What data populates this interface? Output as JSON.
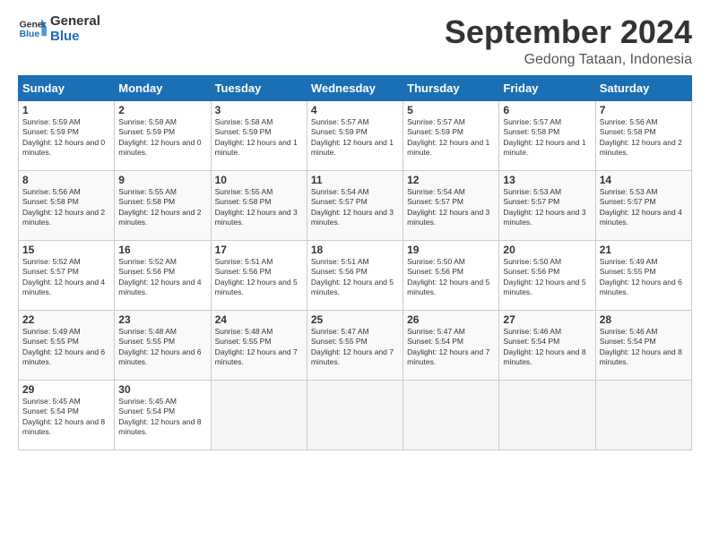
{
  "app": {
    "name": "GeneralBlue",
    "logo_text_line1": "General",
    "logo_text_line2": "Blue"
  },
  "calendar": {
    "month_title": "September 2024",
    "location": "Gedong Tataan, Indonesia",
    "days_of_week": [
      "Sunday",
      "Monday",
      "Tuesday",
      "Wednesday",
      "Thursday",
      "Friday",
      "Saturday"
    ],
    "weeks": [
      [
        {
          "day": "",
          "empty": true
        },
        {
          "day": "",
          "empty": true
        },
        {
          "day": "",
          "empty": true
        },
        {
          "day": "",
          "empty": true
        },
        {
          "day": "",
          "empty": true
        },
        {
          "day": "",
          "empty": true
        },
        {
          "day": "7",
          "sunrise": "5:56 AM",
          "sunset": "5:58 PM",
          "daylight": "12 hours and 2 minutes."
        }
      ],
      [
        {
          "day": "1",
          "sunrise": "5:59 AM",
          "sunset": "5:59 PM",
          "daylight": "12 hours and 0 minutes."
        },
        {
          "day": "2",
          "sunrise": "5:58 AM",
          "sunset": "5:59 PM",
          "daylight": "12 hours and 0 minutes."
        },
        {
          "day": "3",
          "sunrise": "5:58 AM",
          "sunset": "5:59 PM",
          "daylight": "12 hours and 1 minute."
        },
        {
          "day": "4",
          "sunrise": "5:57 AM",
          "sunset": "5:59 PM",
          "daylight": "12 hours and 1 minute."
        },
        {
          "day": "5",
          "sunrise": "5:57 AM",
          "sunset": "5:59 PM",
          "daylight": "12 hours and 1 minute."
        },
        {
          "day": "6",
          "sunrise": "5:57 AM",
          "sunset": "5:58 PM",
          "daylight": "12 hours and 1 minute."
        },
        {
          "day": "7",
          "sunrise": "5:56 AM",
          "sunset": "5:58 PM",
          "daylight": "12 hours and 2 minutes."
        }
      ],
      [
        {
          "day": "8",
          "sunrise": "5:56 AM",
          "sunset": "5:58 PM",
          "daylight": "12 hours and 2 minutes."
        },
        {
          "day": "9",
          "sunrise": "5:55 AM",
          "sunset": "5:58 PM",
          "daylight": "12 hours and 2 minutes."
        },
        {
          "day": "10",
          "sunrise": "5:55 AM",
          "sunset": "5:58 PM",
          "daylight": "12 hours and 3 minutes."
        },
        {
          "day": "11",
          "sunrise": "5:54 AM",
          "sunset": "5:57 PM",
          "daylight": "12 hours and 3 minutes."
        },
        {
          "day": "12",
          "sunrise": "5:54 AM",
          "sunset": "5:57 PM",
          "daylight": "12 hours and 3 minutes."
        },
        {
          "day": "13",
          "sunrise": "5:53 AM",
          "sunset": "5:57 PM",
          "daylight": "12 hours and 3 minutes."
        },
        {
          "day": "14",
          "sunrise": "5:53 AM",
          "sunset": "5:57 PM",
          "daylight": "12 hours and 4 minutes."
        }
      ],
      [
        {
          "day": "15",
          "sunrise": "5:52 AM",
          "sunset": "5:57 PM",
          "daylight": "12 hours and 4 minutes."
        },
        {
          "day": "16",
          "sunrise": "5:52 AM",
          "sunset": "5:56 PM",
          "daylight": "12 hours and 4 minutes."
        },
        {
          "day": "17",
          "sunrise": "5:51 AM",
          "sunset": "5:56 PM",
          "daylight": "12 hours and 5 minutes."
        },
        {
          "day": "18",
          "sunrise": "5:51 AM",
          "sunset": "5:56 PM",
          "daylight": "12 hours and 5 minutes."
        },
        {
          "day": "19",
          "sunrise": "5:50 AM",
          "sunset": "5:56 PM",
          "daylight": "12 hours and 5 minutes."
        },
        {
          "day": "20",
          "sunrise": "5:50 AM",
          "sunset": "5:56 PM",
          "daylight": "12 hours and 5 minutes."
        },
        {
          "day": "21",
          "sunrise": "5:49 AM",
          "sunset": "5:55 PM",
          "daylight": "12 hours and 6 minutes."
        }
      ],
      [
        {
          "day": "22",
          "sunrise": "5:49 AM",
          "sunset": "5:55 PM",
          "daylight": "12 hours and 6 minutes."
        },
        {
          "day": "23",
          "sunrise": "5:48 AM",
          "sunset": "5:55 PM",
          "daylight": "12 hours and 6 minutes."
        },
        {
          "day": "24",
          "sunrise": "5:48 AM",
          "sunset": "5:55 PM",
          "daylight": "12 hours and 7 minutes."
        },
        {
          "day": "25",
          "sunrise": "5:47 AM",
          "sunset": "5:55 PM",
          "daylight": "12 hours and 7 minutes."
        },
        {
          "day": "26",
          "sunrise": "5:47 AM",
          "sunset": "5:54 PM",
          "daylight": "12 hours and 7 minutes."
        },
        {
          "day": "27",
          "sunrise": "5:46 AM",
          "sunset": "5:54 PM",
          "daylight": "12 hours and 8 minutes."
        },
        {
          "day": "28",
          "sunrise": "5:46 AM",
          "sunset": "5:54 PM",
          "daylight": "12 hours and 8 minutes."
        }
      ],
      [
        {
          "day": "29",
          "sunrise": "5:45 AM",
          "sunset": "5:54 PM",
          "daylight": "12 hours and 8 minutes."
        },
        {
          "day": "30",
          "sunrise": "5:45 AM",
          "sunset": "5:54 PM",
          "daylight": "12 hours and 8 minutes."
        },
        {
          "day": "",
          "empty": true
        },
        {
          "day": "",
          "empty": true
        },
        {
          "day": "",
          "empty": true
        },
        {
          "day": "",
          "empty": true
        },
        {
          "day": "",
          "empty": true
        }
      ]
    ]
  }
}
